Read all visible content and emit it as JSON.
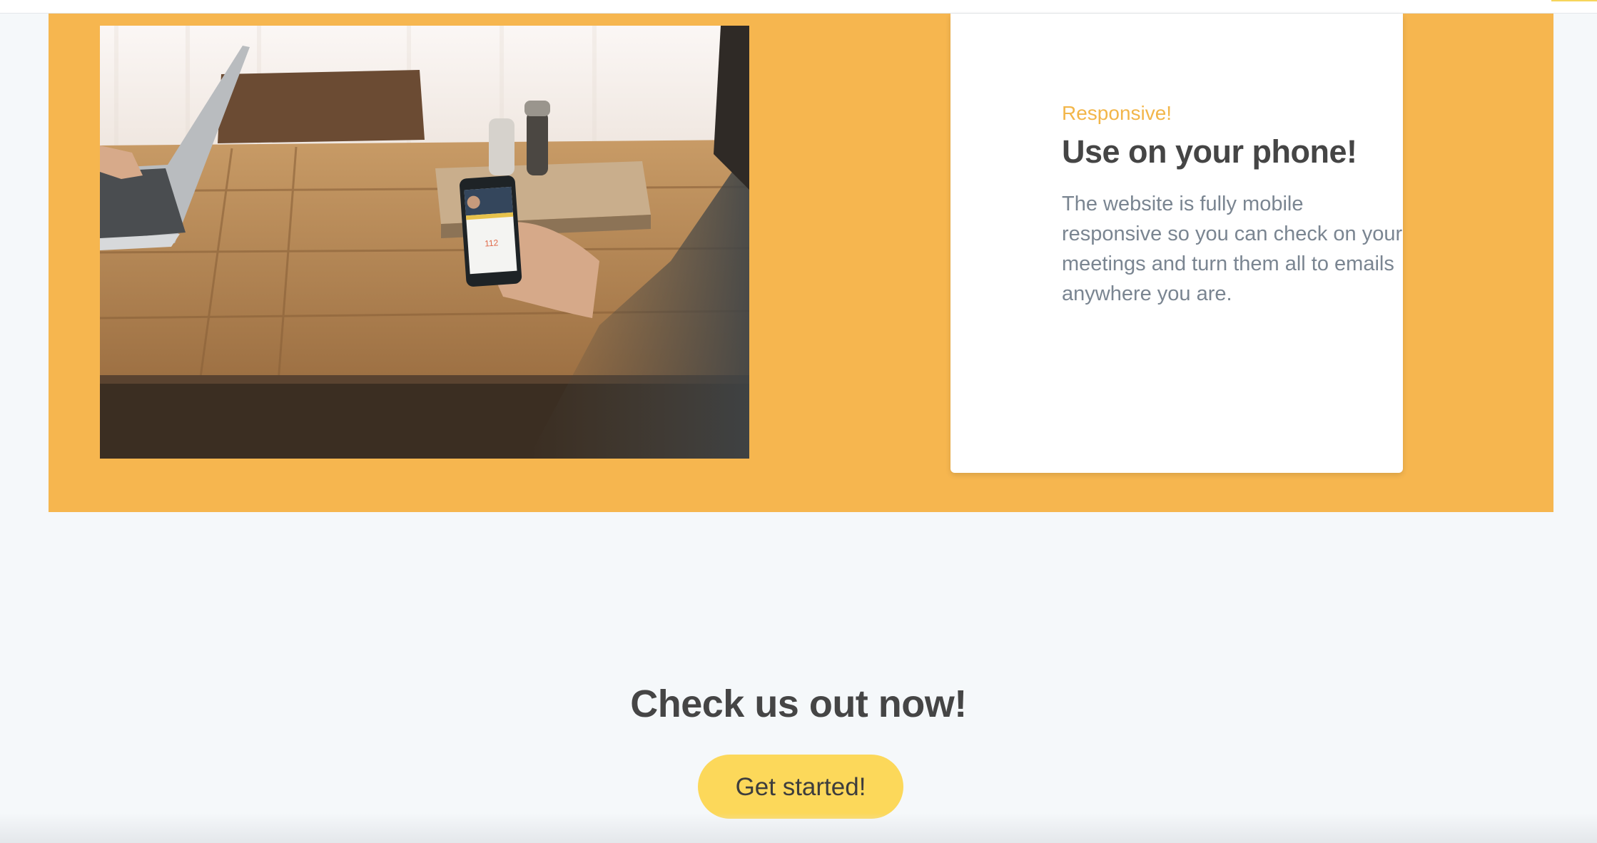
{
  "feature": {
    "eyebrow": "Responsive!",
    "title": "Use on your phone!",
    "description": "The website is fully mobile responsive so you can check on your meetings and turn them all to emails anywhere you are."
  },
  "photo": {
    "phone_number": "112"
  },
  "cta": {
    "title": "Check us out now!",
    "button_label": "Get started!"
  },
  "colors": {
    "band": "#f6b64f",
    "accent_text": "#f2b64a",
    "button": "#fcd85a",
    "heading": "#454545",
    "body_text": "#7a8591",
    "page_bg": "#f5f8fa"
  }
}
